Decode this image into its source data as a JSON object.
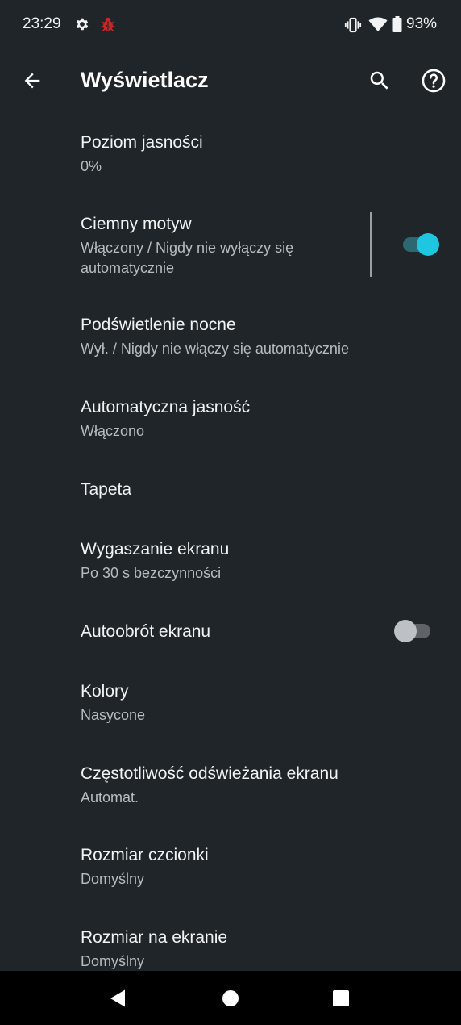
{
  "status_bar": {
    "time": "23:29",
    "battery_percent": "93%",
    "icons": [
      "settings-gear-icon",
      "bug-icon",
      "vibrate-icon",
      "wifi-icon",
      "battery-icon"
    ]
  },
  "app_bar": {
    "title": "Wyświetlacz",
    "actions": [
      "back-arrow-icon",
      "search-icon",
      "help-icon"
    ]
  },
  "settings": [
    {
      "title": "Poziom jasności",
      "subtitle": "0%"
    },
    {
      "title": "Ciemny motyw",
      "subtitle": "Włączony / Nigdy nie wyłączy się automatycznie",
      "toggle": true
    },
    {
      "title": "Podświetlenie nocne",
      "subtitle": "Wył. / Nigdy nie włączy się automatycznie"
    },
    {
      "title": "Automatyczna jasność",
      "subtitle": "Włączono"
    },
    {
      "title": "Tapeta"
    },
    {
      "title": "Wygaszanie ekranu",
      "subtitle": "Po 30 s bezczynności"
    },
    {
      "title": "Autoobrót ekranu",
      "toggle": false
    },
    {
      "title": "Kolory",
      "subtitle": "Nasycone"
    },
    {
      "title": "Częstotliwość odświeżania ekranu",
      "subtitle": "Automat."
    },
    {
      "title": "Rozmiar czcionki",
      "subtitle": "Domyślny"
    },
    {
      "title": "Rozmiar na ekranie",
      "subtitle": "Domyślny"
    }
  ],
  "colors": {
    "background": "#202529",
    "accent": "#1fc6e0",
    "accent_track": "#2d6772",
    "secondary_text": "#b7bcc0"
  },
  "nav_bar": [
    "nav-back-icon",
    "nav-home-icon",
    "nav-recents-icon"
  ]
}
